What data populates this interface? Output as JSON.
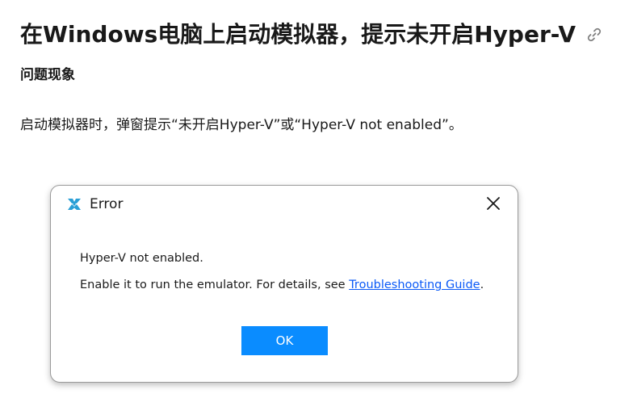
{
  "page": {
    "title": "在Windows电脑上启动模拟器，提示未开启Hyper-V",
    "section_heading": "问题现象",
    "description": "启动模拟器时，弹窗提示“未开启Hyper-V”或“Hyper-V not enabled”。",
    "link_icon": "link-icon"
  },
  "dialog": {
    "title": "Error",
    "app_icon": "emulator-logo-icon",
    "close_icon": "close-icon",
    "message_line1": "Hyper-V not enabled.",
    "message_line2_prefix": "Enable it to run the emulator. For details, see ",
    "message_line2_link": "Troubleshooting Guide",
    "message_line2_suffix": ".",
    "ok_label": "OK"
  },
  "colors": {
    "link": "#0a59f7",
    "ok_button": "#0a8cff",
    "logo_blue": "#2a9fd6"
  }
}
